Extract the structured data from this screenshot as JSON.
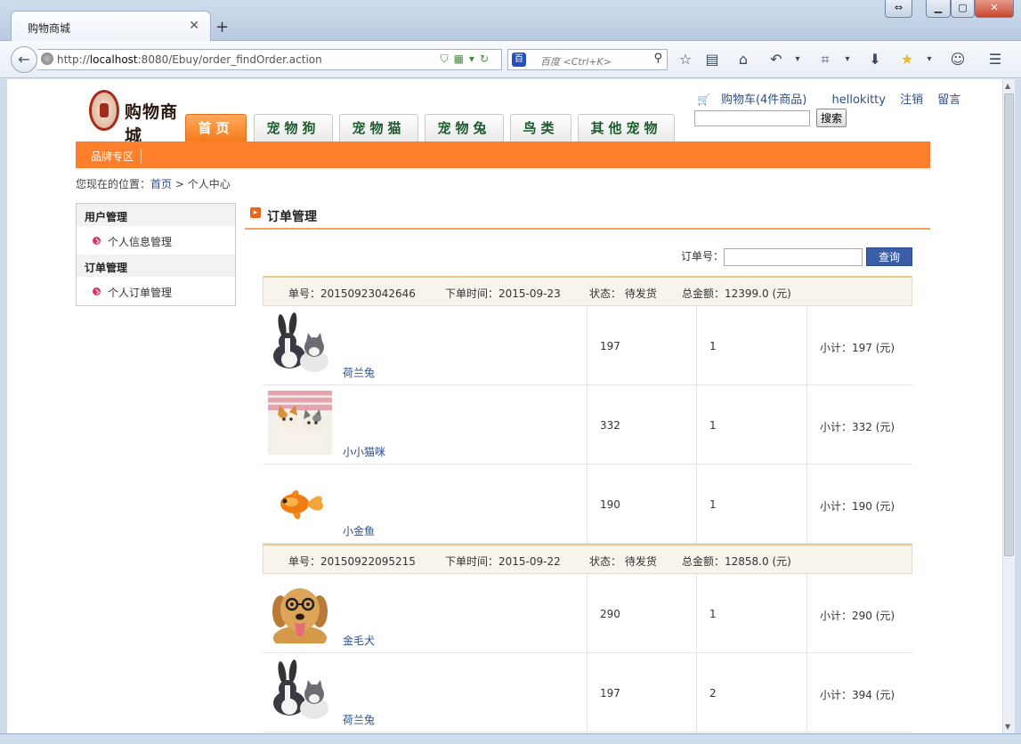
{
  "browser": {
    "tab_title": "购物商城",
    "url_prefix": "http://",
    "url_host": "localhost",
    "url_rest": ":8080/Ebuy/order_findOrder.action",
    "search_placeholder": "百度 <Ctrl+K>",
    "search_engine": "百"
  },
  "site": {
    "logo_text": "购物商城",
    "cart_link": "购物车(4件商品)",
    "username": "hellokitty",
    "logout": "注销",
    "message": "留言",
    "search_button": "搜索"
  },
  "nav": {
    "tabs": [
      {
        "label": "首页",
        "active": true
      },
      {
        "label": "宠物狗",
        "active": false
      },
      {
        "label": "宠物猫",
        "active": false
      },
      {
        "label": "宠物兔",
        "active": false
      },
      {
        "label": "鸟类",
        "active": false
      },
      {
        "label": "其他宠物",
        "active": false
      }
    ],
    "brand_zone": "品牌专区"
  },
  "breadcrumb": {
    "prefix": "您现在的位置：",
    "home": "首页",
    "sep": " > ",
    "current": "个人中心"
  },
  "sidebar": {
    "sections": [
      {
        "title": "用户管理",
        "items": [
          "个人信息管理"
        ]
      },
      {
        "title": "订单管理",
        "items": [
          "个人订单管理"
        ]
      }
    ]
  },
  "main": {
    "title": "订单管理",
    "query_label": "订单号：",
    "query_button": "查询"
  },
  "orders": [
    {
      "number": "单号：20150923042646",
      "time": "下单时间：2015-09-23",
      "status": "状态： 待发货",
      "total": "总金额：12399.0 (元)",
      "items": [
        {
          "name": "荷兰兔",
          "price": "197",
          "qty": "1",
          "subtotal": "小计：197 (元)",
          "img": "rabbit-cat"
        },
        {
          "name": "小小猫咪",
          "price": "332",
          "qty": "1",
          "subtotal": "小计：332 (元)",
          "img": "kittens"
        },
        {
          "name": "小金鱼",
          "price": "190",
          "qty": "1",
          "subtotal": "小计：190 (元)",
          "img": "goldfish"
        }
      ]
    },
    {
      "number": "单号：20150922095215",
      "time": "下单时间：2015-09-22",
      "status": "状态： 待发货",
      "total": "总金额：12858.0 (元)",
      "items": [
        {
          "name": "金毛犬",
          "price": "290",
          "qty": "1",
          "subtotal": "小计：290 (元)",
          "img": "golden-dog"
        },
        {
          "name": "荷兰兔",
          "price": "197",
          "qty": "2",
          "subtotal": "小计：394 (元)",
          "img": "rabbit-cat"
        }
      ]
    }
  ],
  "colors": {
    "accent_orange": "#fd7f2c",
    "link_blue": "#2d4f8a",
    "nav_green": "#1d5a2c"
  }
}
